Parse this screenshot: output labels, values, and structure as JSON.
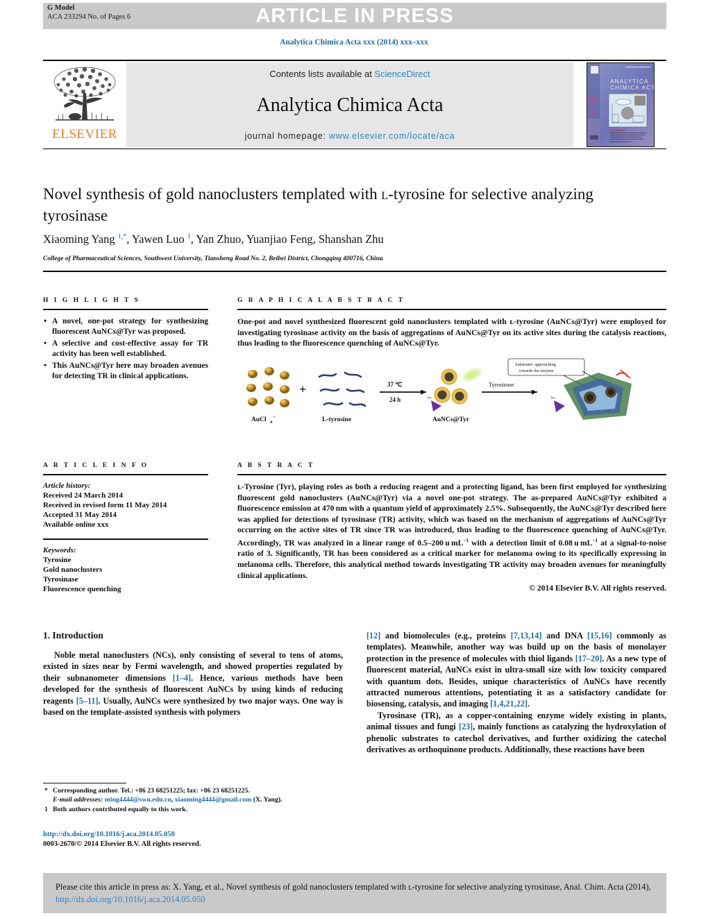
{
  "banner": {
    "g_model": "G Model",
    "article_id": "ACA 233294 No. of Pages 6",
    "article_in_press": "ARTICLE IN PRESS"
  },
  "running_head": "Analytica Chimica Acta xxx (2014) xxx–xxx",
  "masthead": {
    "contents_text": "Contents lists available at ",
    "sciencedirect": "ScienceDirect",
    "journal_title": "Analytica Chimica Acta",
    "homepage_label": "journal homepage: ",
    "homepage_url": "www.elsevier.com/locate/aca",
    "publisher": "ELSEVIER",
    "cover_title_line1": "ANALYTICA",
    "cover_title_line2": "CHIMICA ACTA"
  },
  "article": {
    "title": "Novel synthesis of gold nanoclusters templated with ʟ-tyrosine for selective analyzing tyrosinase",
    "authors_html": "Xiaoming Yang <sup>1,*</sup>, Yawen Luo <sup>1</sup>, Yan Zhuo, Yuanjiao Feng, Shanshan Zhu",
    "affiliation": "College of Pharmaceutical Sciences, Southwest University, Tiansheng Road No. 2, Beibei District, Chongqing 400716, China"
  },
  "highlights": {
    "label": "H I G H L I G H T S",
    "items": [
      "A novel, one-pot strategy for synthesizing fluorescent AuNCs@Tyr was proposed.",
      "A selective and cost-effective assay for TR activity has been well established.",
      "This AuNCs@Tyr here may broaden avenues for detecting TR in clinical applications."
    ]
  },
  "graphical_abstract": {
    "label": "G R A P H I C A L   A B S T R A C T",
    "text": "One-pot and novel synthesized fluorescent gold nanoclusters templated with ʟ-tyrosine (AuNCs@Tyr) were employed for investigating tyrosinase activity on the basis of aggregations of AuNCs@Tyr on its active sites during the catalysis reactions, thus leading to the fluorescence quenching of AuNCs@Tyr.",
    "figure": {
      "reactant_left": "AuCl₄⁻",
      "reactant_right": "L-tyrosine",
      "plus": "+",
      "arrow1_top": "37 ℃",
      "arrow1_bottom": "24 h",
      "product1": "AuNCs@Tyr",
      "arrow2_label": "Tyrosinase",
      "callout": "Substrates' approaching towards the enzyme"
    }
  },
  "article_info": {
    "label": "A R T I C L E   I N F O",
    "history_label": "Article history:",
    "history": [
      "Received 24 March 2014",
      "Received in revised form 11 May 2014",
      "Accepted 31 May 2014",
      "Available online xxx"
    ],
    "keywords_label": "Keywords:",
    "keywords": [
      "Tyrosine",
      "Gold nanoclusters",
      "Tyrosinase",
      "Fluorescence quenching"
    ]
  },
  "abstract": {
    "label": "A B S T R A C T",
    "text_html": "ʟ-Tyrosine (Tyr), playing roles as both a reducing reagent and a protecting ligand, has been first employed for synthesizing fluorescent gold nanoclusters (AuNCs@Tyr) via a novel one-pot strategy. The as-prepared AuNCs@Tyr exhibited a fluorescence emission at 470&thinsp;nm with a quantum yield of approximately 2.5%. Subsequently, the AuNCs@Tyr described here was applied for detections of tyrosinase (TR) activity, which was based on the mechanism of aggregations of AuNCs@Tyr occurring on the active sites of TR since TR was introduced, thus leading to the fluorescence quenching of AuNCs@Tyr. Accordingly, TR was analyzed in a linear range of 0.5–200&thinsp;u&thinsp;mL<sup>−1</sup> with a detection limit of 0.08&thinsp;u&thinsp;mL<sup>−1</sup> at a signal-to-noise ratio of 3. Significantly, TR has been considered as a critical marker for melanoma owing to its specifically expressing in melanoma cells. Therefore, this analytical method towards investigating TR activity may broaden avenues for meaningfully clinical applications.",
    "copyright": "© 2014 Elsevier B.V. All rights reserved."
  },
  "body": {
    "section_heading": "1. Introduction",
    "left_paragraph_html": "Noble metal nanoclusters (NCs), only consisting of several to tens of atoms, existed in sizes near by Fermi wavelength, and showed properties regulated by their subnanometer dimensions <span class=\"ref\">[1–4]</span>. Hence, various methods have been developed for the synthesis of fluorescent AuNCs by using kinds of reducing reagents <span class=\"ref\">[5–11]</span>. Usually, AuNCs were synthesized by two major ways. One way is based on the template-assisted synthesis with polymers",
    "right_paragraph1_html": "<span class=\"ref\">[12]</span> and biomolecules (e.g., proteins <span class=\"ref\">[7,13,14]</span> and DNA <span class=\"ref\">[15,16]</span> commonly as templates). Meanwhile, another way was build up on the basis of monolayer protection in the presence of molecules with thiol ligands <span class=\"ref\">[17–20]</span>. As a new type of fluorescent material, AuNCs exist in ultra-small size with low toxicity compared with quantum dots. Besides, unique characteristics of AuNCs have recently attracted numerous attentions, potentiating it as a satisfactory candidate for biosensing, catalysis, and imaging <span class=\"ref\">[1,4,21,22]</span>.",
    "right_paragraph2_html": "Tyrosinase (TR), as a copper-containing enzyme widely existing in plants, animal tissues and fungi <span class=\"ref\">[23]</span>, mainly functions as catalyzing the hydroxylation of phenolic substrates to catechol derivatives, and further oxidizing the catechol derivatives as orthoquinone products. Additionally, these reactions have been"
  },
  "footnotes": {
    "corresponding_mark": "*",
    "corresponding_html": "Corresponding author. Tel.: +86 23 68251225; fax: +86 23 68251225.",
    "email_label": "E-mail addresses:",
    "email1": "ming4444@swu.edu.cn",
    "email2": "xiaoming4444@gmail.com",
    "email_suffix": "(X. Yang).",
    "equal_mark": "1",
    "equal_contribution": "Both authors contributed equally to this work.",
    "doi_url": "http://dx.doi.org/10.1016/j.aca.2014.05.050",
    "issn_line": "0003-2670/© 2014 Elsevier B.V. All rights reserved."
  },
  "citation_box": {
    "text_before": "Please cite this article in press as: X. Yang, et al., Novel synthesis of gold nanoclusters templated with ʟ-tyrosine for selective analyzing tyrosinase, Anal. Chim. Acta (2014), ",
    "doi": "http://dx.doi.org/10.1016/j.aca.2014.05.050"
  },
  "colors": {
    "link_blue": "#1a6ba8",
    "sciencedirect_blue": "#2a84c8",
    "elsevier_orange": "#ef7d20",
    "banner_grey": "#c9c9c9",
    "masthead_grey": "#e6e6e6"
  }
}
